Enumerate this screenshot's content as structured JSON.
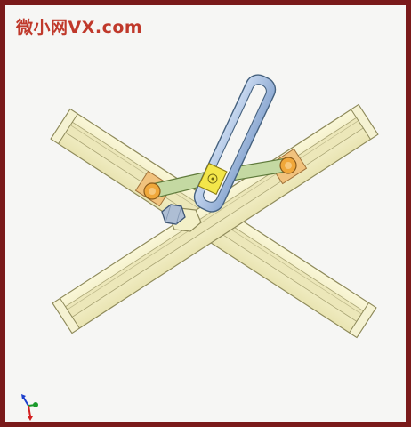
{
  "watermark": {
    "text": "微小网VX.com"
  },
  "colors": {
    "frame": "#7a1a1a",
    "background": "#f6f6f4",
    "rail_fill": "#f3f0c8",
    "rail_stroke": "#8e8a5a",
    "slot_frame": "#a9c3e6",
    "slot_stroke": "#46627f",
    "link_green": "#c4d9a2",
    "slider_orange": "#f1c27d",
    "pin_orange": "#f0a73a",
    "center_block": "#f3e64a",
    "bolt": "#aebed4",
    "watermark": "#c0392b"
  },
  "icons": {
    "axis_triad": "axis-triad-icon",
    "bolt": "hex-bolt-icon"
  }
}
